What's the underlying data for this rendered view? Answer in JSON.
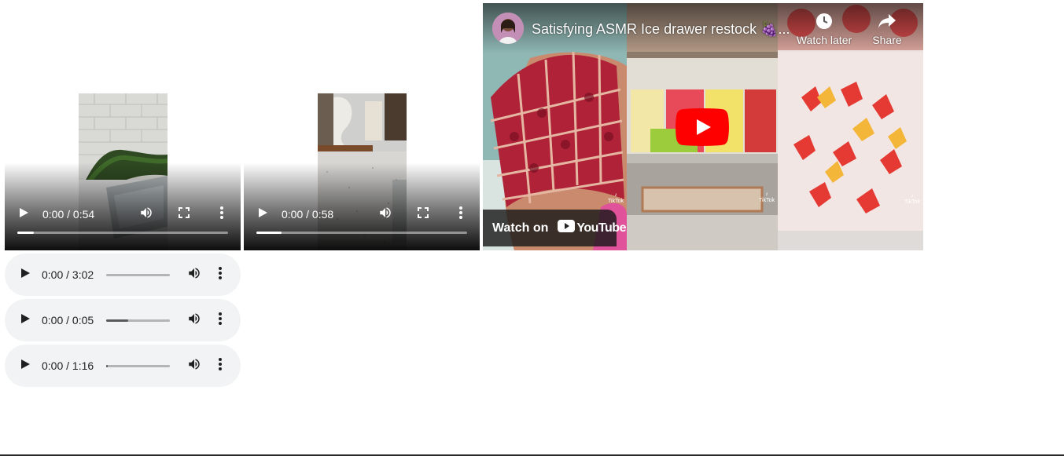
{
  "videos": [
    {
      "time": "0:00 / 0:54",
      "progress": 0.08
    },
    {
      "time": "0:00 / 0:58",
      "progress": 0.12
    }
  ],
  "audios": [
    {
      "time": "0:00 / 3:02",
      "progress": 0.0
    },
    {
      "time": "0:00 / 0:05",
      "progress": 0.34
    },
    {
      "time": "0:00 / 1:16",
      "progress": 0.02
    }
  ],
  "youtube": {
    "title": "Satisfying ASMR Ice drawer restock 🍇...",
    "watch_later_label": "Watch later",
    "share_label": "Share",
    "watch_on_label": "Watch on",
    "logo_word": "YouTube",
    "watermark": "TikTok",
    "colors": {
      "play_red": "#ff0000",
      "overlay": "#171717"
    }
  },
  "icons": {
    "play": "play-icon",
    "volume": "volume-icon",
    "fullscreen": "fullscreen-icon",
    "more": "more-vert-icon",
    "clock": "clock-icon",
    "share": "share-icon"
  }
}
